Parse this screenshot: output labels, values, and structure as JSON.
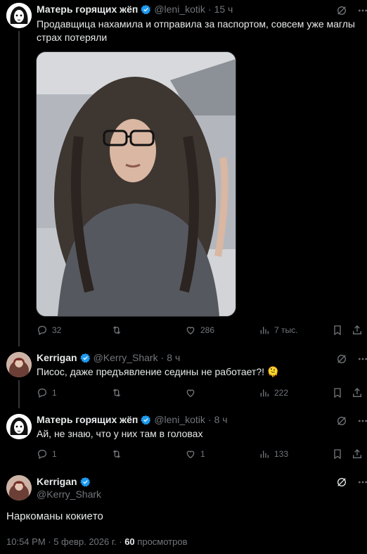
{
  "tweets": [
    {
      "name": "Матерь горящих жёп",
      "handle": "@leni_kotik",
      "dot": "·",
      "time": "15 ч",
      "text": "Продавщица нахамила и отправила за паспортом, совсем уже маглы страх потеряли",
      "actions": {
        "replies": "32",
        "retweets": "",
        "likes": "286",
        "views": "7 тыс."
      }
    },
    {
      "name": "Kerrigan",
      "handle": "@Kerry_Shark",
      "dot": "·",
      "time": "8 ч",
      "text": "Писос, даже предъявление седины не работает?!",
      "emoji": "🫠",
      "actions": {
        "replies": "1",
        "retweets": "",
        "likes": "",
        "views": "222"
      }
    },
    {
      "name": "Матерь горящих жёп",
      "handle": "@leni_kotik",
      "dot": "·",
      "time": "8 ч",
      "text": "Ай, не знаю, что у них там в головах",
      "actions": {
        "replies": "1",
        "retweets": "",
        "likes": "1",
        "views": "133"
      }
    }
  ],
  "main": {
    "name": "Kerrigan",
    "handle": "@Kerry_Shark",
    "text": "Наркоманы кокиeто",
    "meta_time": "10:54 PM · 5 февр. 2026 г. ·",
    "views_count": "60",
    "views_label": "просмотров"
  },
  "colors": {
    "accent": "#1d9bf0",
    "muted": "#71767b",
    "text": "#e7e9ea",
    "background": "#000000"
  }
}
